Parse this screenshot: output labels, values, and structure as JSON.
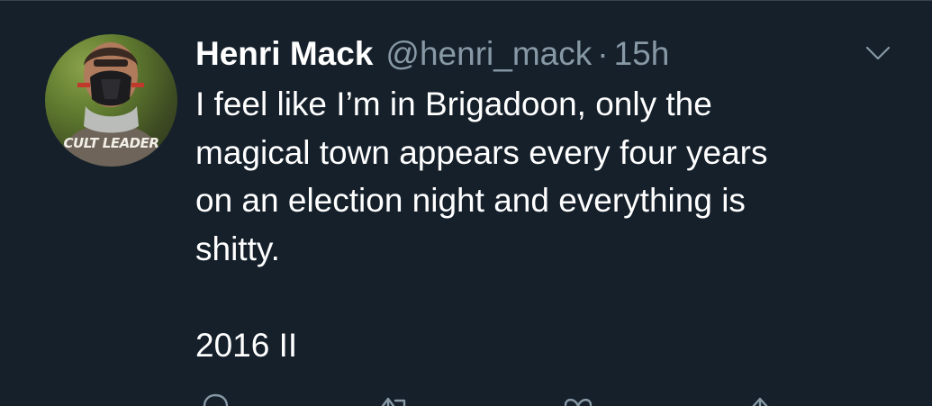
{
  "user": {
    "name": "Henri Mack",
    "handle": "@henri_mack",
    "separator": "·",
    "time": "15h",
    "avatar_text": "CULT LEADER"
  },
  "tweet": {
    "lines": [
      "I feel like I’m in Brigadoon, only the",
      "magical town appears every four years",
      "on an election night and everything is",
      "shitty."
    ],
    "footer": "2016 II"
  },
  "icons": {
    "caret": "chevron-down-icon",
    "reply": "reply-icon",
    "retweet": "retweet-icon",
    "like": "heart-icon",
    "share": "share-icon"
  },
  "colors": {
    "background": "#15202b",
    "secondary_text": "#8899a6",
    "divider": "#38444d"
  }
}
